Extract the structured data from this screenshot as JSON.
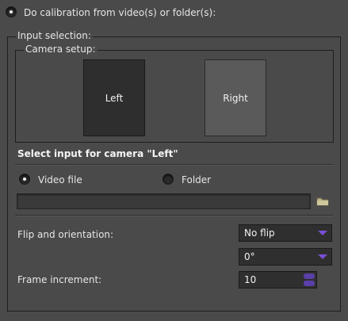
{
  "option": {
    "label": "Do calibration from video(s) or folder(s):"
  },
  "input_selection": {
    "title": "Input selection:"
  },
  "camera_setup": {
    "title": "Camera setup:",
    "left_label": "Left",
    "right_label": "Right"
  },
  "select_heading": "Select input for camera \"Left\"",
  "source": {
    "video_label": "Video file",
    "folder_label": "Folder",
    "path_value": ""
  },
  "flip": {
    "label": "Flip and orientation:",
    "flip_value": "No flip",
    "rotation_value": "0°"
  },
  "frame": {
    "label": "Frame increment:",
    "value": "10"
  },
  "icons": {
    "folder": "folder-icon",
    "dropdown": "chevron-down-icon"
  },
  "colors": {
    "accent": "#7b4fd6",
    "background": "#4a4a4a"
  }
}
